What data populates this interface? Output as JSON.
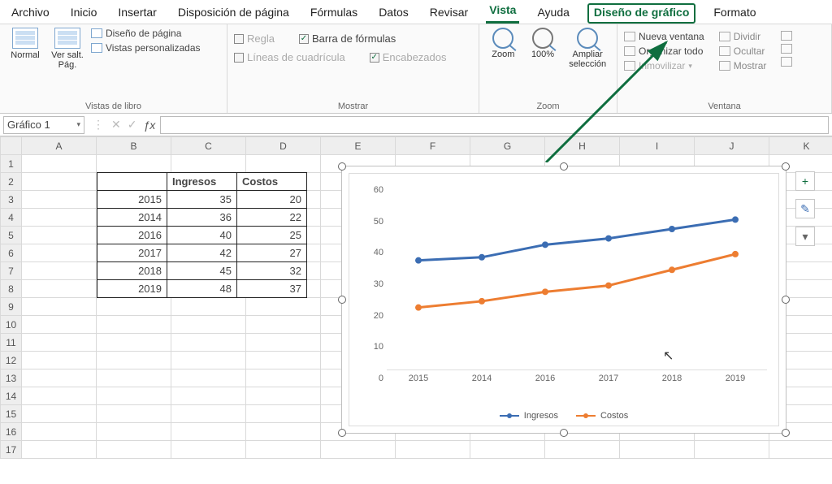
{
  "menu": {
    "items": [
      "Archivo",
      "Inicio",
      "Insertar",
      "Disposición de página",
      "Fórmulas",
      "Datos",
      "Revisar",
      "Vista",
      "Ayuda",
      "Diseño de gráfico",
      "Formato"
    ],
    "activeIndex": 7,
    "highlightIndex": 9
  },
  "ribbon": {
    "group_views": {
      "label": "Vistas de libro",
      "normal": "Normal",
      "pagebreak": "Ver salt. Pág.",
      "pagelayout": "Diseño de página",
      "custom": "Vistas personalizadas"
    },
    "group_show": {
      "label": "Mostrar",
      "ruler": "Regla",
      "gridlines": "Líneas de cuadrícula",
      "formulabar": "Barra de fórmulas",
      "headings": "Encabezados"
    },
    "group_zoom": {
      "label": "Zoom",
      "zoom": "Zoom",
      "z100": "100%",
      "zoomsel": "Ampliar selección"
    },
    "group_window": {
      "label": "Ventana",
      "newwin": "Nueva ventana",
      "arrange": "Organizar todo",
      "freeze": "Inmovilizar",
      "split": "Dividir",
      "hide": "Ocultar",
      "show": "Mostrar"
    }
  },
  "namebox": "Gráfico 1",
  "fx_value": "",
  "columns": [
    "A",
    "B",
    "C",
    "D",
    "E",
    "F",
    "G",
    "H",
    "I",
    "J",
    "K"
  ],
  "rows": 17,
  "data_table": {
    "headers": [
      "",
      "Ingresos",
      "Costos"
    ],
    "rows": [
      [
        "2015",
        35,
        20
      ],
      [
        "2014",
        36,
        22
      ],
      [
        "2016",
        40,
        25
      ],
      [
        "2017",
        42,
        27
      ],
      [
        "2018",
        45,
        32
      ],
      [
        "2019",
        48,
        37
      ]
    ]
  },
  "chart_data": {
    "type": "line",
    "categories": [
      "2015",
      "2014",
      "2016",
      "2017",
      "2018",
      "2019"
    ],
    "series": [
      {
        "name": "Ingresos",
        "values": [
          35,
          36,
          40,
          42,
          45,
          48
        ],
        "color": "#3b6db3"
      },
      {
        "name": "Costos",
        "values": [
          20,
          22,
          25,
          27,
          32,
          37
        ],
        "color": "#ed7d31"
      }
    ],
    "ylim": [
      0,
      60
    ],
    "yticks": [
      0,
      10,
      20,
      30,
      40,
      50,
      60
    ],
    "title": "",
    "xlabel": "",
    "ylabel": ""
  },
  "chart_tools": {
    "plus": "+",
    "brush": "brush-icon",
    "filter": "filter-icon"
  }
}
